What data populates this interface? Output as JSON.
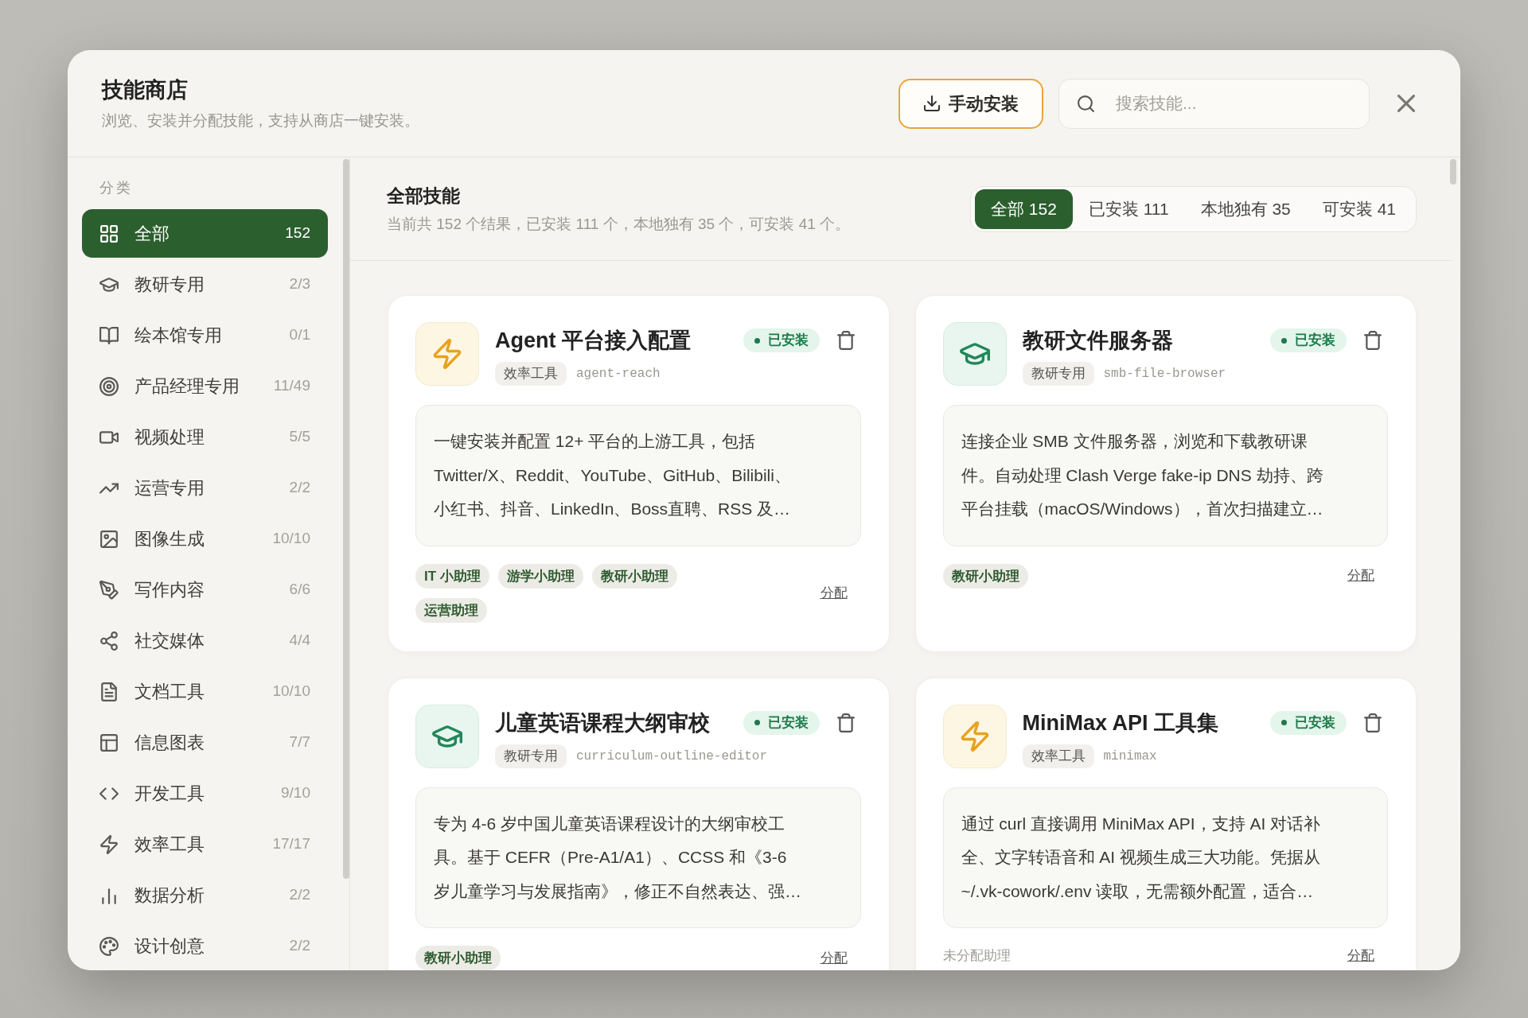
{
  "dialog": {
    "title": "技能商店",
    "subtitle": "浏览、安装并分配技能，支持从商店一键安装。",
    "install_button": "手动安装",
    "search": {
      "placeholder": "搜索技能..."
    }
  },
  "sidebar": {
    "heading": "分类",
    "items": [
      {
        "label": "全部",
        "count": "152",
        "selected": true
      },
      {
        "label": "教研专用",
        "count": "2/3",
        "selected": false
      },
      {
        "label": "绘本馆专用",
        "count": "0/1",
        "selected": false
      },
      {
        "label": "产品经理专用",
        "count": "11/49",
        "selected": false
      },
      {
        "label": "视频处理",
        "count": "5/5",
        "selected": false
      },
      {
        "label": "运营专用",
        "count": "2/2",
        "selected": false
      },
      {
        "label": "图像生成",
        "count": "10/10",
        "selected": false
      },
      {
        "label": "写作内容",
        "count": "6/6",
        "selected": false
      },
      {
        "label": "社交媒体",
        "count": "4/4",
        "selected": false
      },
      {
        "label": "文档工具",
        "count": "10/10",
        "selected": false
      },
      {
        "label": "信息图表",
        "count": "7/7",
        "selected": false
      },
      {
        "label": "开发工具",
        "count": "9/10",
        "selected": false
      },
      {
        "label": "效率工具",
        "count": "17/17",
        "selected": false
      },
      {
        "label": "数据分析",
        "count": "2/2",
        "selected": false
      },
      {
        "label": "设计创意",
        "count": "2/2",
        "selected": false
      }
    ]
  },
  "main": {
    "title": "全部技能",
    "summary": "当前共 152 个结果，已安装 111 个，本地独有 35 个，可安装 41 个。",
    "filters": [
      {
        "label": "全部 152",
        "selected": true
      },
      {
        "label": "已安装 111",
        "selected": false
      },
      {
        "label": "本地独有 35",
        "selected": false
      },
      {
        "label": "可安装 41",
        "selected": false
      }
    ]
  },
  "skills": [
    {
      "name": "Agent 平台接入配置",
      "status": "已安装",
      "category": "效率工具",
      "slug": "agent-reach",
      "description": [
        "一键安装并配置 12+ 平台的上游工具，包括",
        "Twitter/X、Reddit、YouTube、GitHub、Bilibili、",
        "小红书、抖音、LinkedIn、Boss直聘、RSS 及…"
      ],
      "assistants": [
        "IT 小助理",
        "游学小助理",
        "教研小助理",
        "运营助理"
      ],
      "assign_link": "分配"
    },
    {
      "name": "教研文件服务器",
      "status": "已安装",
      "category": "教研专用",
      "slug": "smb-file-browser",
      "description": [
        "连接企业 SMB 文件服务器，浏览和下载教研课",
        "件。自动处理 Clash Verge fake-ip DNS 劫持、跨",
        "平台挂载（macOS/Windows），首次扫描建立…"
      ],
      "assistants": [
        "教研小助理"
      ],
      "assign_link": "分配"
    },
    {
      "name": "儿童英语课程大纲审校",
      "status": "已安装",
      "category": "教研专用",
      "slug": "curriculum-outline-editor",
      "description": [
        "专为 4-6 岁中国儿童英语课程设计的大纲审校工",
        "具。基于 CEFR（Pre-A1/A1）、CCSS 和《3-6",
        "岁儿童学习与发展指南》，修正不自然表达、强…"
      ],
      "assistants": [
        "教研小助理"
      ],
      "assign_link": "分配"
    },
    {
      "name": "MiniMax API 工具集",
      "status": "已安装",
      "category": "效率工具",
      "slug": "minimax",
      "description": [
        "通过 curl 直接调用 MiniMax API，支持 AI 对话补",
        "全、文字转语音和 AI 视频生成三大功能。凭据从",
        "~/.vk-cowork/.env 读取，无需额外配置，适合…"
      ],
      "unassigned_note": "未分配助理",
      "assign_link": "分配"
    }
  ]
}
